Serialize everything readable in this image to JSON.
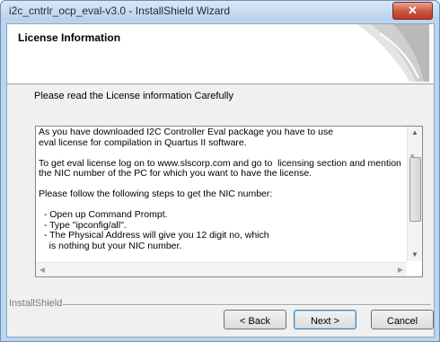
{
  "window": {
    "title": "i2c_cntrlr_ocp_eval-v3.0 - InstallShield Wizard",
    "close_glyph": "✕"
  },
  "header": {
    "title": "License Information"
  },
  "intro": "Please read the License information Carefully",
  "license_text": "As you have downloaded I2C Controller Eval package you have to use\neval license for compilation in Quartus II software.\n\nTo get eval license log on to www.slscorp.com and go to  licensing section and mention\nthe NIC number of the PC for which you want to have the license.\n\nPlease follow the following steps to get the NIC number:\n\n  - Open up Command Prompt.\n  - Type \"ipconfig/all\".\n  - The Physical Address will give you 12 digit no, which\n    is nothing but your NIC number.",
  "scrollbar": {
    "up": "▲",
    "down": "▼",
    "left": "◀",
    "right": "▶",
    "grip": "≡"
  },
  "footer": {
    "brand": "InstallShield",
    "back_label": "< Back",
    "next_label": "Next >",
    "cancel_label": "Cancel"
  }
}
